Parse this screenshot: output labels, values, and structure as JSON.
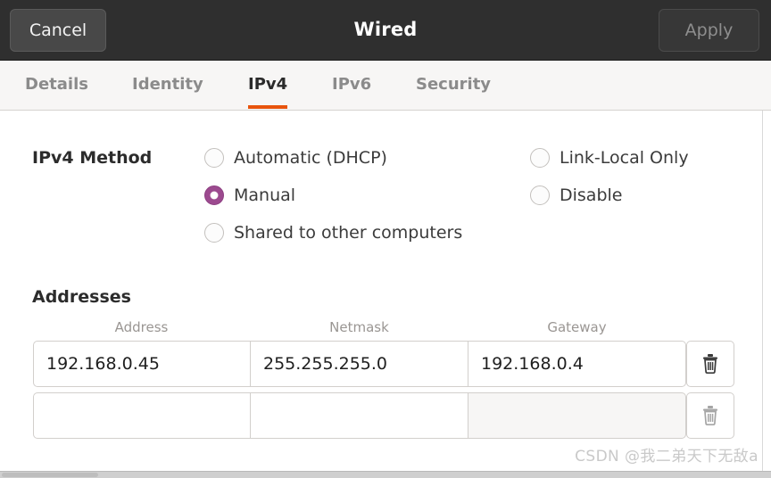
{
  "window": {
    "title": "Wired",
    "cancel_label": "Cancel",
    "apply_label": "Apply"
  },
  "colors": {
    "header_bg": "#2f2f2f",
    "accent_tab_underline": "#e8540c",
    "radio_selected": "#9c4a8f",
    "tabbar_bg": "#f7f6f5"
  },
  "tabs": [
    {
      "label": "Details",
      "active": false
    },
    {
      "label": "Identity",
      "active": false
    },
    {
      "label": "IPv4",
      "active": true
    },
    {
      "label": "IPv6",
      "active": false
    },
    {
      "label": "Security",
      "active": false
    }
  ],
  "ipv4_method": {
    "label": "IPv4 Method",
    "options_left": [
      {
        "label": "Automatic (DHCP)",
        "selected": false
      },
      {
        "label": "Manual",
        "selected": true
      },
      {
        "label": "Shared to other computers",
        "selected": false
      }
    ],
    "options_right": [
      {
        "label": "Link-Local Only",
        "selected": false
      },
      {
        "label": "Disable",
        "selected": false
      }
    ]
  },
  "addresses": {
    "label": "Addresses",
    "columns": [
      "Address",
      "Netmask",
      "Gateway"
    ],
    "rows": [
      {
        "address": "192.168.0.45",
        "netmask": "255.255.255.0",
        "gateway": "192.168.0.4",
        "gateway_disabled": false,
        "delete_icon": "trash-icon",
        "delete_dim": false
      },
      {
        "address": "",
        "netmask": "",
        "gateway": "",
        "gateway_disabled": true,
        "delete_icon": "trash-icon",
        "delete_dim": true
      }
    ]
  },
  "watermark": {
    "text": "CSDN @我二弟天下无敌a"
  }
}
